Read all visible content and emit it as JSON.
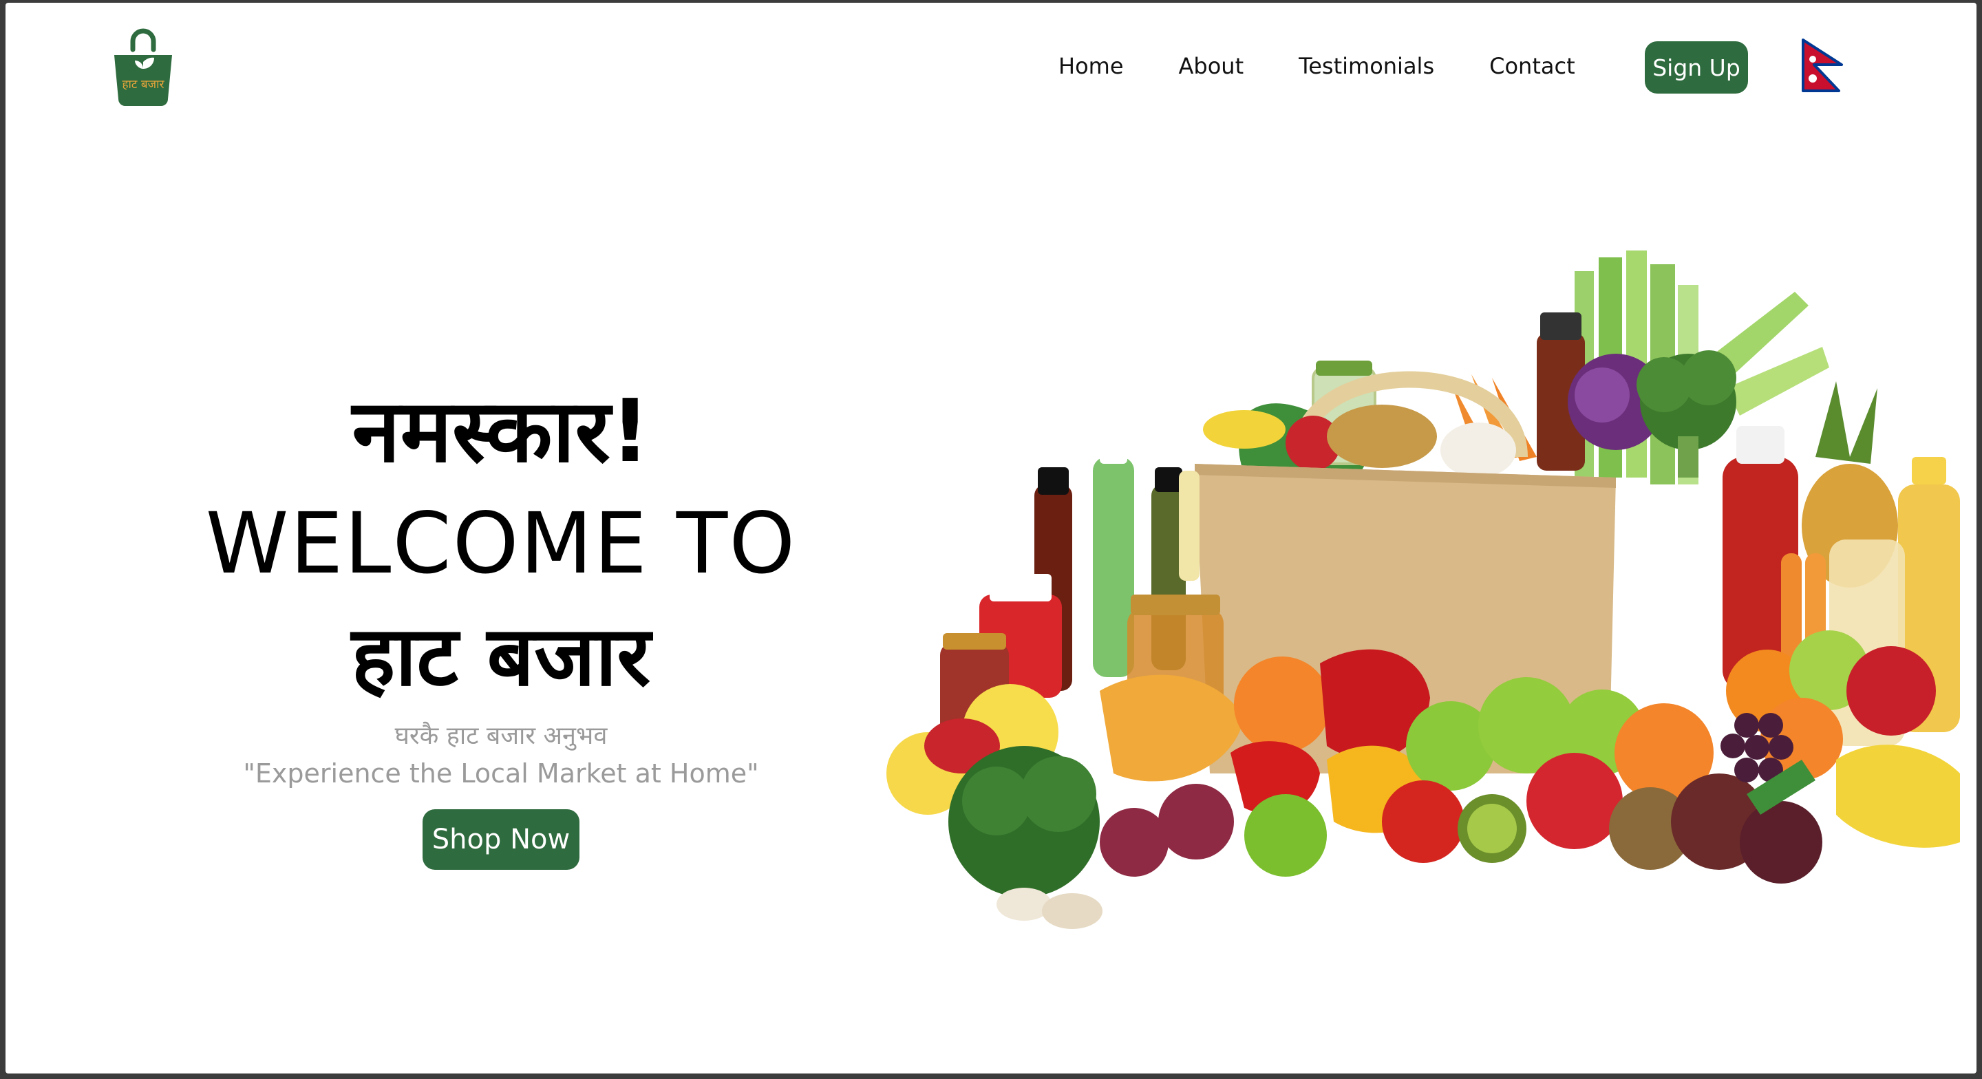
{
  "header": {
    "logo_text": "हाट बजार",
    "nav": [
      "Home",
      "About",
      "Testimonials",
      "Contact"
    ],
    "signup_label": "Sign Up",
    "flag_icon": "nepal-flag-icon"
  },
  "hero": {
    "greeting": "नमस्कार!",
    "welcome": "WELCOME TO",
    "brand": "हाट बजार",
    "subtitle_np": "घरकै हाट बजार अनुभव",
    "subtitle_en": "\"Experience the Local Market at Home\"",
    "cta_label": "Shop Now"
  },
  "colors": {
    "brand_green": "#2e6b3e",
    "logo_text_orange": "#e8a53a",
    "subtitle_gray": "#9a9a9a"
  },
  "image": {
    "icon": "grocery-bag-illustration"
  }
}
